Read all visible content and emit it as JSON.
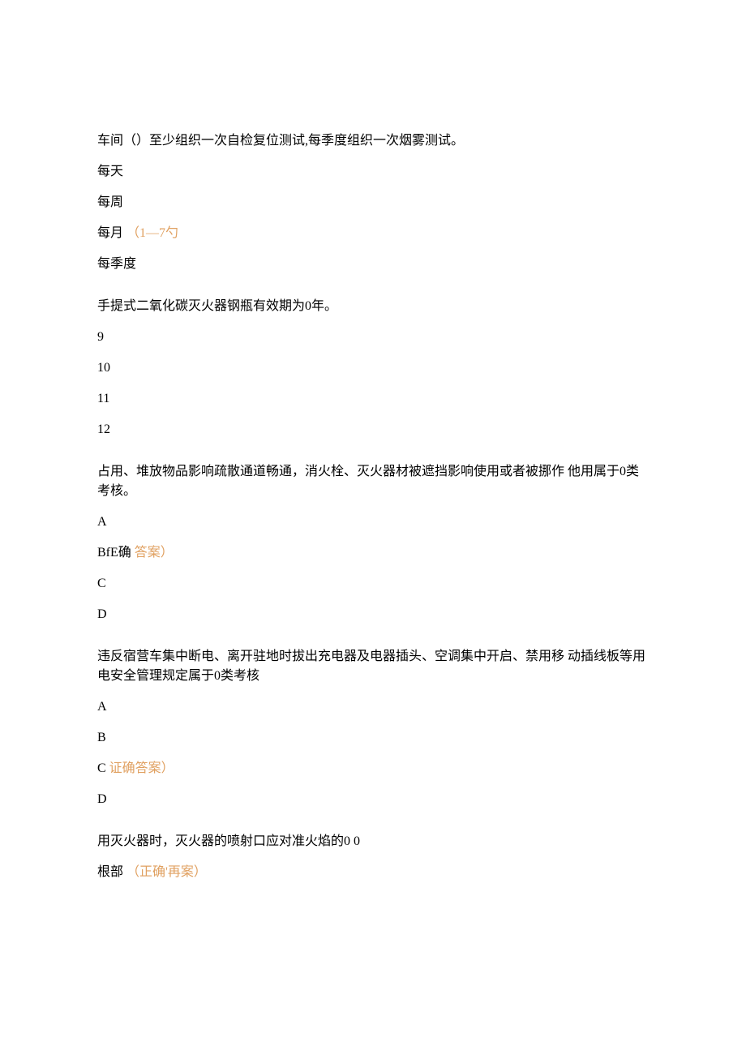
{
  "questions": [
    {
      "text": "车间（）至少组织一次自检复位测试,每季度组织一次烟雾测试。",
      "options": [
        {
          "prefix": "每天",
          "mark": "",
          "suffix": ""
        },
        {
          "prefix": "每周",
          "mark": "",
          "suffix": ""
        },
        {
          "prefix": "每月",
          "mark": "（1—7勺",
          "suffix": ""
        },
        {
          "prefix": "每季度",
          "mark": "",
          "suffix": ""
        }
      ]
    },
    {
      "text": "手提式二氧化碳灭火器钢瓶有效期为0年。",
      "options": [
        {
          "prefix": "9",
          "mark": "",
          "suffix": ""
        },
        {
          "prefix": "10",
          "mark": "",
          "suffix": ""
        },
        {
          "prefix": "11",
          "mark": "",
          "suffix": ""
        },
        {
          "prefix": "12",
          "mark": "",
          "suffix": ""
        }
      ]
    },
    {
      "text": "占用、堆放物品影响疏散通道畅通，消火栓、灭火器材被遮挡影响使用或者被挪作 他用属于0类考核。",
      "options": [
        {
          "prefix": "A",
          "mark": "",
          "suffix": ""
        },
        {
          "prefix": "BfE确",
          "mark": "答案）",
          "suffix": ""
        },
        {
          "prefix": "C",
          "mark": "",
          "suffix": ""
        },
        {
          "prefix": "D",
          "mark": "",
          "suffix": ""
        }
      ]
    },
    {
      "text": "违反宿营车集中断电、离开驻地时拔出充电器及电器插头、空调集中开启、禁用移 动插线板等用电安全管理规定属于0类考核",
      "options": [
        {
          "prefix": "A",
          "mark": "",
          "suffix": ""
        },
        {
          "prefix": "B",
          "mark": "",
          "suffix": ""
        },
        {
          "prefix": "C",
          "mark": "证确答案）",
          "suffix": ""
        },
        {
          "prefix": "D",
          "mark": "",
          "suffix": ""
        }
      ]
    },
    {
      "text": "用灭火器时，灭火器的喷射口应对准火焰的0 0",
      "options": [
        {
          "prefix": "根部",
          "mark": "（正确'再案）",
          "suffix": ""
        }
      ]
    }
  ]
}
